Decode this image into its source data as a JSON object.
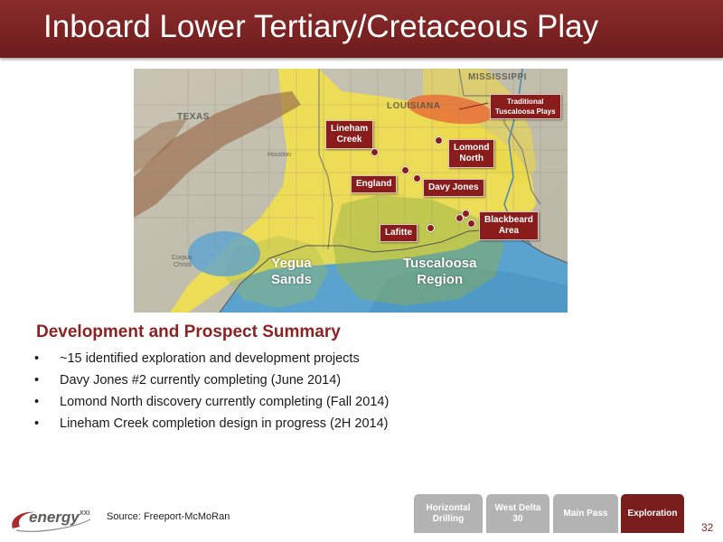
{
  "slide": {
    "title": "Inboard Lower Tertiary/Cretaceous Play",
    "page_number": "32",
    "source": "Source: Freeport-McMoRan"
  },
  "map": {
    "state_labels": {
      "mississippi": "MISSISSIPPI",
      "louisiana": "LOUISIANA",
      "texas": "TEXAS"
    },
    "city_labels": {
      "houston": "Houston",
      "corpus_christi_1": "Corpus",
      "corpus_christi_2": "Christi"
    },
    "regions": {
      "yegua_line1": "Yegua",
      "yegua_line2": "Sands",
      "tuscaloosa_line1": "Tuscaloosa",
      "tuscaloosa_line2": "Region"
    },
    "callouts": {
      "traditional_line1": "Traditional",
      "traditional_line2": "Tuscaloosa Plays",
      "lineham_line1": "Lineham",
      "lineham_line2": "Creek",
      "lomond_line1": "Lomond",
      "lomond_line2": "North",
      "england": "England",
      "davy_jones": "Davy Jones",
      "blackbeard_line1": "Blackbeard",
      "blackbeard_line2": "Area",
      "lafitte": "Lafitte"
    },
    "colors": {
      "marker": "#8a1c1c",
      "callout_bg": "#8a1c1c",
      "yellow_play": "#f3e24a",
      "water": "#5ea9d6"
    }
  },
  "summary": {
    "heading": "Development and Prospect Summary",
    "bullet_glyph": "•",
    "bullets": [
      "~15 identified exploration and development projects",
      "Davy Jones #2 currently completing (June 2014)",
      "Lomond North discovery currently completing (Fall 2014)",
      "Lineham Creek completion design in progress (2H 2014)"
    ]
  },
  "logo": {
    "text": "energy",
    "sup": "XXI"
  },
  "nav": {
    "tabs": [
      {
        "line1": "Horizontal",
        "line2": "Drilling",
        "active": false
      },
      {
        "line1": "West Delta",
        "line2": "30",
        "active": false
      },
      {
        "line1": "Main Pass",
        "line2": "",
        "active": false
      },
      {
        "line1": "Exploration",
        "line2": "",
        "active": true
      }
    ]
  }
}
